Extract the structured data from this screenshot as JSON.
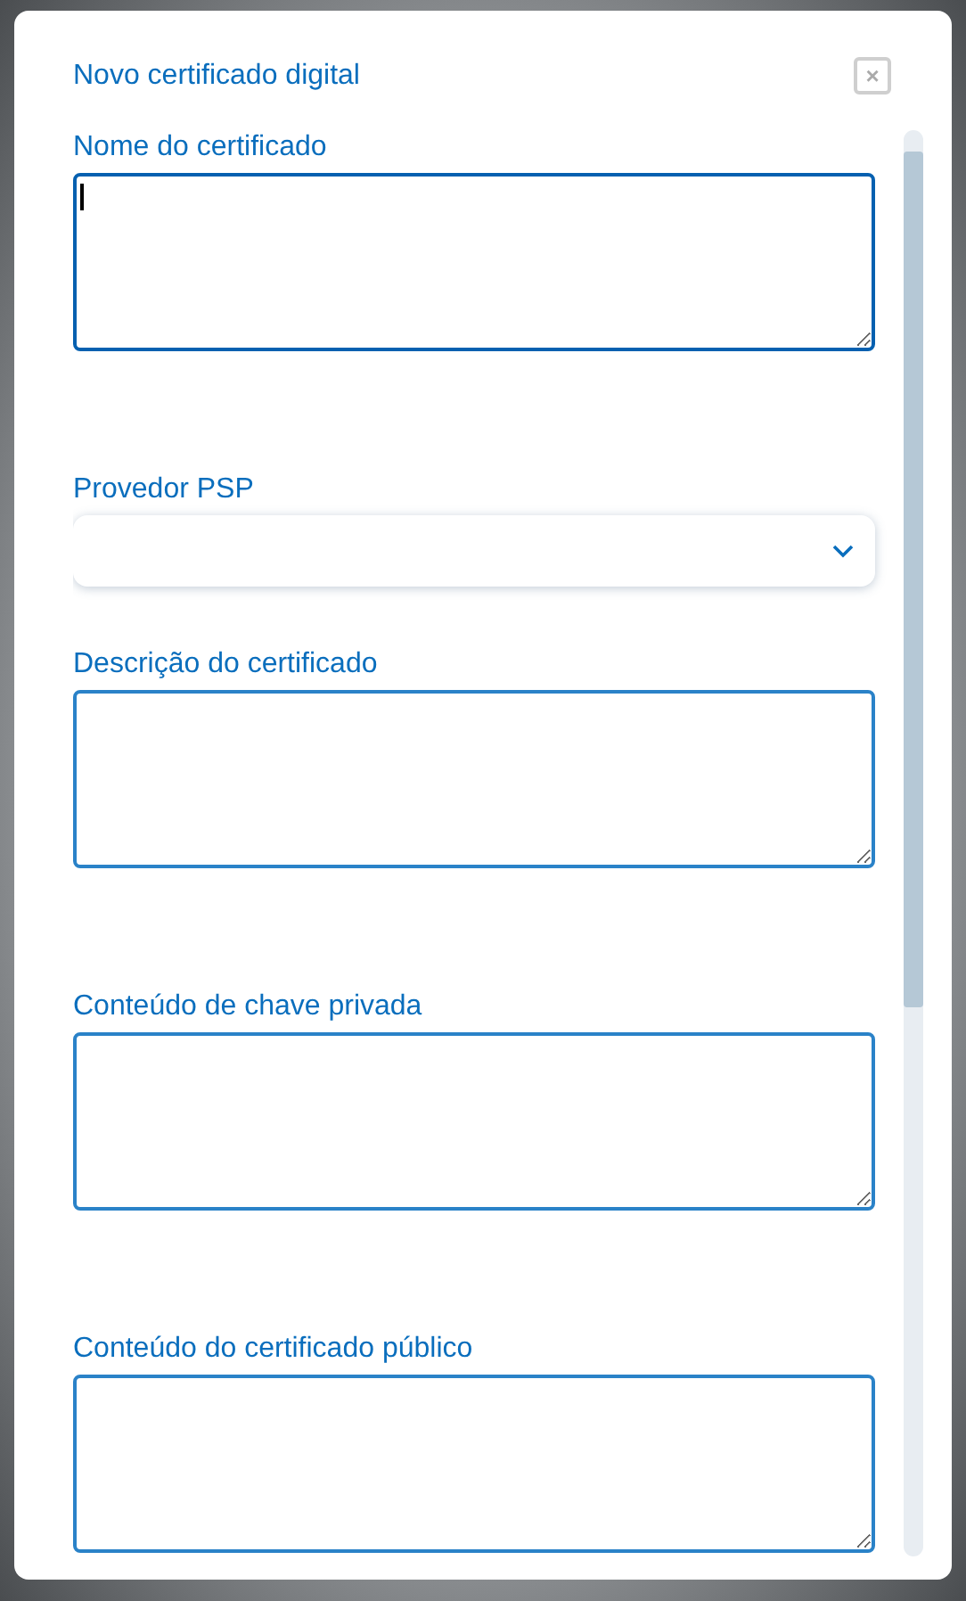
{
  "dialog": {
    "title": "Novo certificado digital",
    "close_button": "×"
  },
  "fields": [
    {
      "kind": "textarea",
      "label": "Nome do certificado",
      "focused": true
    },
    {
      "kind": "select",
      "label": "Provedor PSP",
      "focused": false
    },
    {
      "kind": "textarea",
      "label": "Descrição do certificado",
      "focused": false
    },
    {
      "kind": "textarea",
      "label": "Conteúdo de chave privada",
      "focused": false
    },
    {
      "kind": "textarea",
      "label": "Conteúdo do certificado público",
      "focused": false
    }
  ]
}
